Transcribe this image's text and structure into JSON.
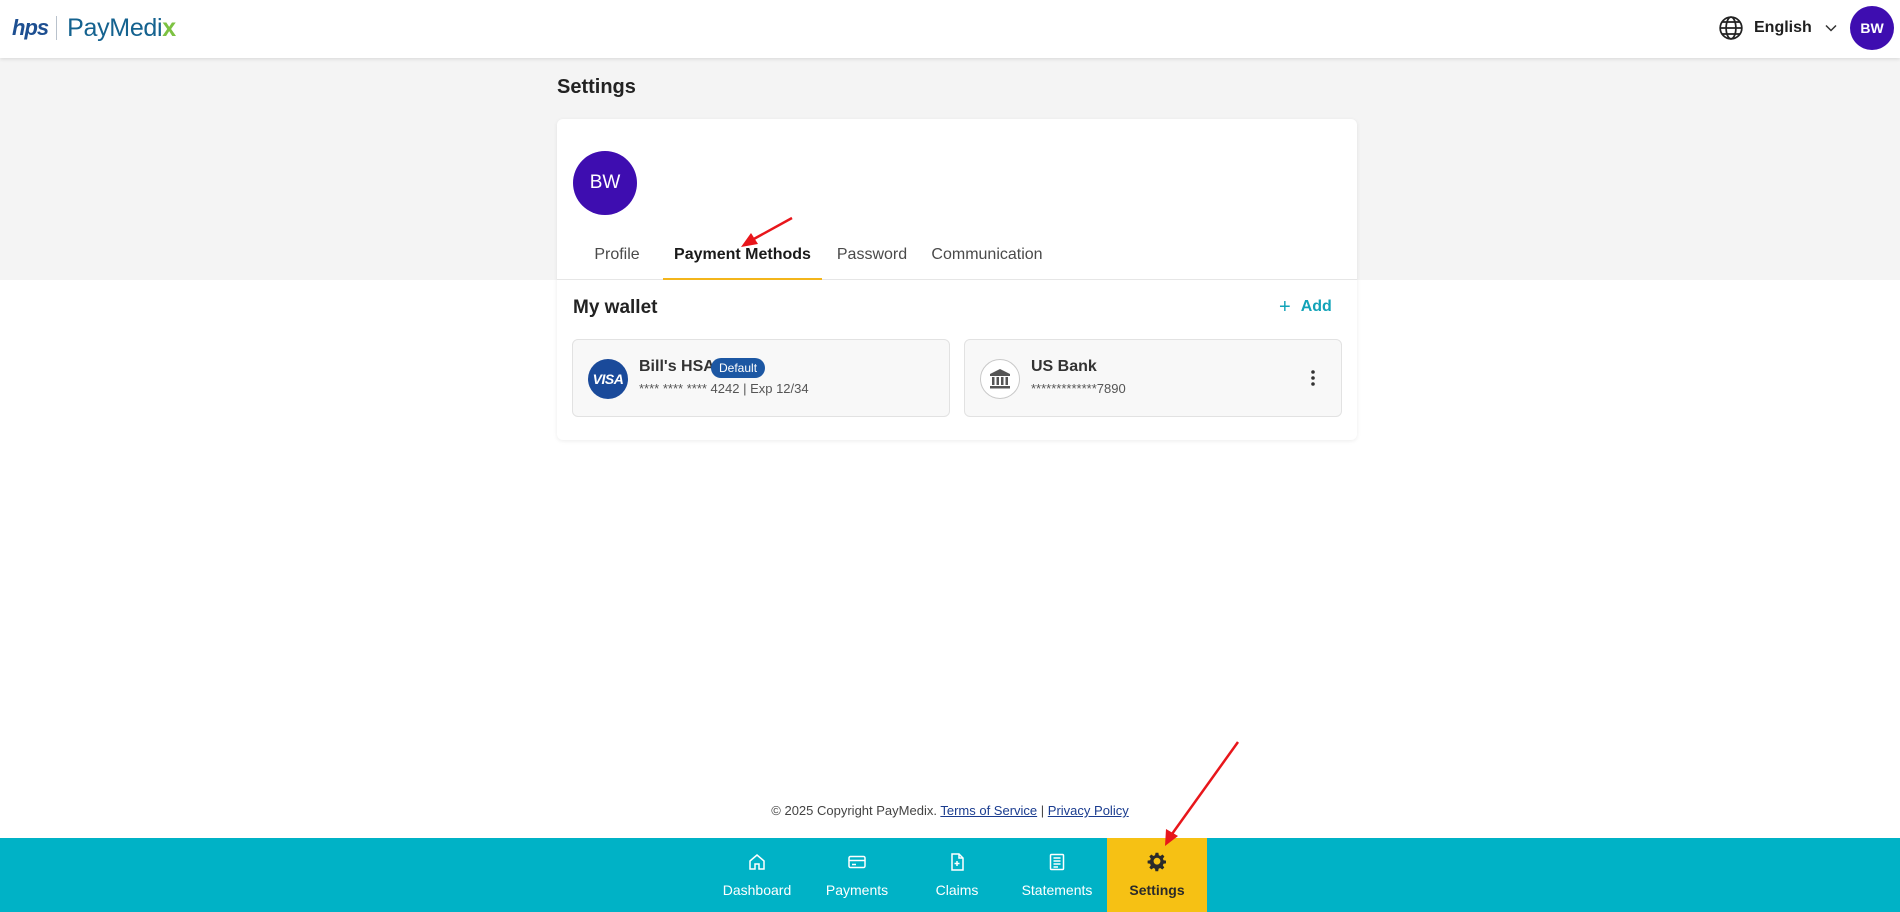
{
  "header": {
    "logo_hps": "hps",
    "logo_paymedix": "PayMedi",
    "logo_x": "x",
    "language": "English",
    "avatar_initials": "BW"
  },
  "page": {
    "title": "Settings",
    "avatar_initials": "BW",
    "tabs": [
      {
        "label": "Profile",
        "active": false
      },
      {
        "label": "Payment Methods",
        "active": true
      },
      {
        "label": "Password",
        "active": false
      },
      {
        "label": "Communication",
        "active": false
      }
    ]
  },
  "wallet": {
    "title": "My wallet",
    "add_label": "Add",
    "methods": [
      {
        "icon": "visa-icon",
        "name": "Bill's HSA",
        "badge": "Default",
        "detail": "**** **** **** 4242 | Exp 12/34"
      },
      {
        "icon": "bank-icon",
        "name": "US Bank",
        "detail": "*************7890"
      }
    ]
  },
  "footer": {
    "copyright": "© 2025 Copyright PayMedix.",
    "terms": "Terms of Service",
    "separator": "|",
    "privacy": "Privacy Policy"
  },
  "bottom_nav": {
    "items": [
      {
        "label": "Dashboard",
        "icon": "home-icon",
        "active": false
      },
      {
        "label": "Payments",
        "icon": "credit-card-icon",
        "active": false
      },
      {
        "label": "Claims",
        "icon": "document-icon",
        "active": false
      },
      {
        "label": "Statements",
        "icon": "statement-icon",
        "active": false
      },
      {
        "label": "Settings",
        "icon": "gear-icon",
        "active": true
      }
    ]
  },
  "colors": {
    "brand_teal": "#00b2c6",
    "active_yellow": "#f6c114",
    "avatar_purple": "#3e0db0",
    "annotation_red": "#e8161b"
  }
}
